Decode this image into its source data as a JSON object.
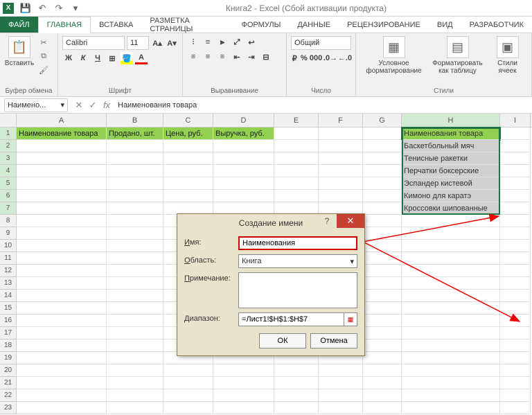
{
  "titlebar": {
    "title": "Книга2 - Excel (Сбой активации продукта)"
  },
  "tabs": {
    "file": "ФАЙЛ",
    "items": [
      "ГЛАВНАЯ",
      "ВСТАВКА",
      "РАЗМЕТКА СТРАНИЦЫ",
      "ФОРМУЛЫ",
      "ДАННЫЕ",
      "РЕЦЕНЗИРОВАНИЕ",
      "ВИД",
      "РАЗРАБОТЧИК"
    ],
    "active": 0
  },
  "ribbon": {
    "clipboard": {
      "paste": "Вставить",
      "group": "Буфер обмена"
    },
    "font": {
      "name": "Calibri",
      "size": "11",
      "group": "Шрифт"
    },
    "align": {
      "group": "Выравнивание"
    },
    "number": {
      "format": "Общий",
      "group": "Число"
    },
    "styles": {
      "cond": "Условное форматирование",
      "table": "Форматировать как таблицу",
      "cell": "Стили ячеек",
      "group": "Стили"
    }
  },
  "formula_bar": {
    "name_box": "Наимено...",
    "fx": "fx",
    "value": "Наименования товара"
  },
  "columns": [
    "A",
    "B",
    "C",
    "D",
    "E",
    "F",
    "G",
    "H",
    "I"
  ],
  "header_row": {
    "A": "Наименование товара",
    "B": "Продано, шт.",
    "C": "Цена, руб.",
    "D": "Выручка, руб."
  },
  "range_H": [
    "Наименования товара",
    "Баскетбольный мяч",
    "Тенисные ракетки",
    "Перчатки боксерские",
    "Эспандер кистевой",
    "Кимоно для каратэ",
    "Кроссовки шипованные"
  ],
  "dialog": {
    "title": "Создание имени",
    "labels": {
      "name": "Имя:",
      "scope": "Область:",
      "comment": "Примечание:",
      "range": "Диапазон:"
    },
    "name_value": "Наименования",
    "scope_value": "Книга",
    "range_value": "=Лист1!$H$1:$H$7",
    "ok": "ОК",
    "cancel": "Отмена"
  }
}
